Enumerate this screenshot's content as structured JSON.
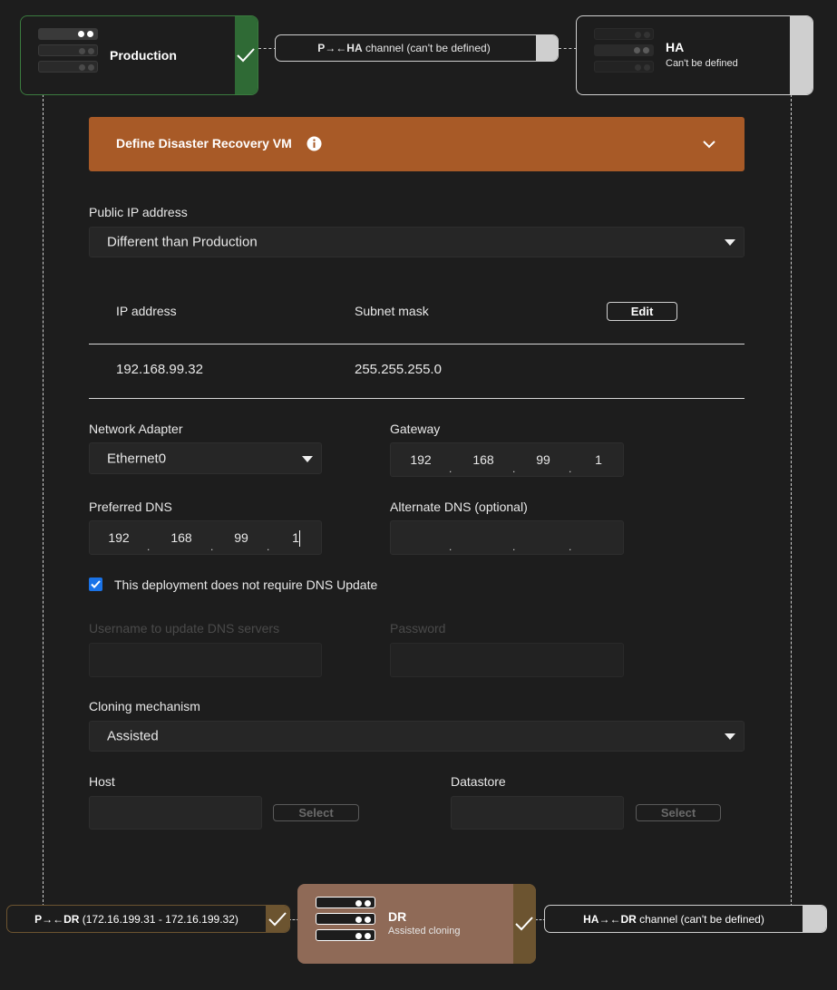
{
  "nodes": {
    "production": {
      "title": "Production"
    },
    "ha": {
      "title": "HA",
      "subtitle": "Can't be defined"
    },
    "dr": {
      "title": "DR",
      "subtitle": "Assisted cloning"
    }
  },
  "channels": {
    "p_ha": {
      "bold": "P→←HA",
      "rest": " channel (can't be defined)"
    },
    "p_dr": {
      "bold": "P→←DR",
      "rest": " (172.16.199.31 - 172.16.199.32)"
    },
    "ha_dr": {
      "bold": "HA→←DR",
      "rest": " channel (can't be defined)"
    }
  },
  "panel": {
    "header_title": "Define Disaster Recovery VM",
    "public_ip_label": "Public IP address",
    "public_ip_value": "Different than Production",
    "table": {
      "col_ip": "IP address",
      "col_mask": "Subnet mask",
      "edit_label": "Edit",
      "row_ip": "192.168.99.32",
      "row_mask": "255.255.255.0"
    },
    "network_adapter_label": "Network Adapter",
    "network_adapter_value": "Ethernet0",
    "gateway_label": "Gateway",
    "gateway": [
      "192",
      "168",
      "99",
      "1"
    ],
    "preferred_dns_label": "Preferred DNS",
    "preferred_dns": [
      "192",
      "168",
      "99",
      "1"
    ],
    "alternate_dns_label": "Alternate DNS (optional)",
    "dns_update_checkbox": "This deployment does not require DNS Update",
    "dns_update_checked": true,
    "username_label": "Username to update DNS servers",
    "password_label": "Password",
    "cloning_label": "Cloning mechanism",
    "cloning_value": "Assisted",
    "host_label": "Host",
    "datastore_label": "Datastore",
    "select_label": "Select"
  },
  "colors": {
    "production_accent": "#2f6a35",
    "header_orange": "#a85a27",
    "dr_card": "#8f6a57",
    "dr_accent": "#6c5430",
    "check_blue": "#1a73e8"
  }
}
